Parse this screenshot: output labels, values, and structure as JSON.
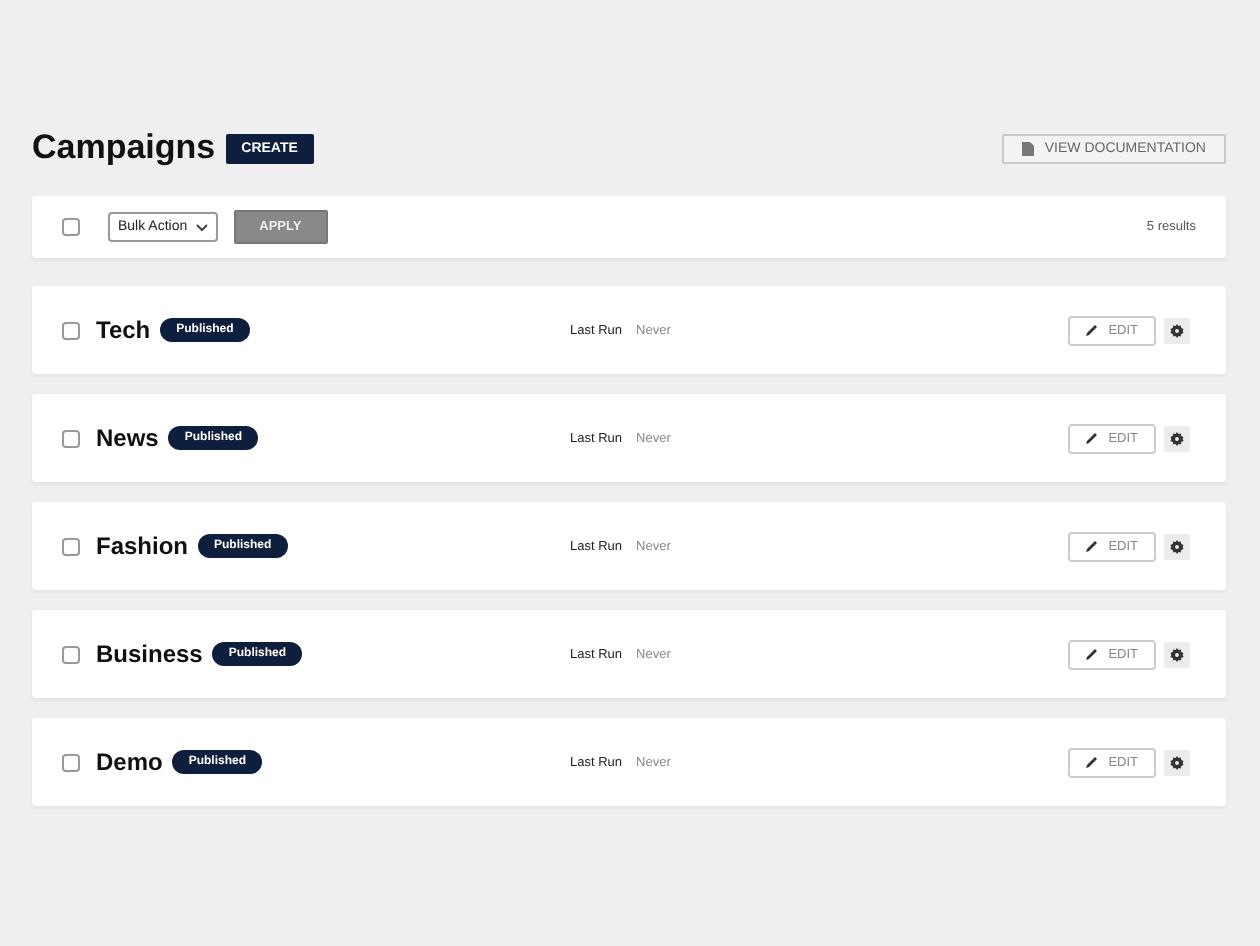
{
  "header": {
    "title": "Campaigns",
    "create_button": "CREATE",
    "docs_button": "VIEW DOCUMENTATION"
  },
  "toolbar": {
    "checked": false,
    "bulk_action": "Bulk Action",
    "apply_button": "APPLY",
    "results": "5 results"
  },
  "campaigns": [
    {
      "name": "Tech",
      "status": "Published",
      "checked": false,
      "last_run_label": "Last Run",
      "last_run": "Never",
      "edit": "EDIT"
    },
    {
      "name": "News",
      "status": "Published",
      "checked": false,
      "last_run_label": "Last Run",
      "last_run": "Never",
      "edit": "EDIT"
    },
    {
      "name": "Fashion",
      "status": "Published",
      "checked": false,
      "last_run_label": "Last Run",
      "last_run": "Never",
      "edit": "EDIT"
    },
    {
      "name": "Business",
      "status": "Published",
      "checked": false,
      "last_run_label": "Last Run",
      "last_run": "Never",
      "edit": "EDIT"
    },
    {
      "name": "Demo",
      "status": "Published",
      "checked": false,
      "last_run_label": "Last Run",
      "last_run": "Never",
      "edit": "EDIT"
    }
  ]
}
